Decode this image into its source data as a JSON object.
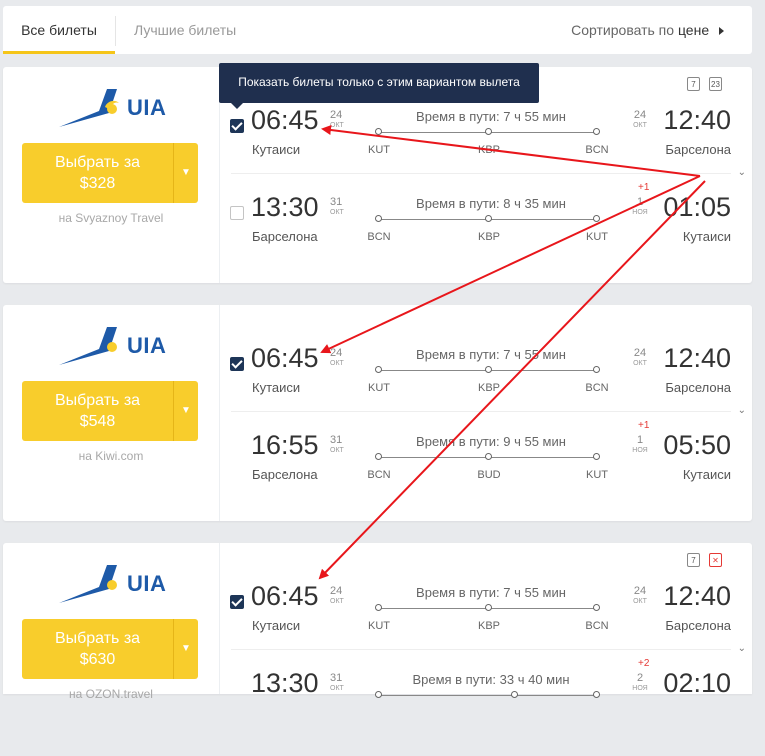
{
  "tabs": {
    "all": "Все билеты",
    "best": "Лучшие билеты"
  },
  "sort": {
    "prefix": "Сортировать по",
    "field": "цене"
  },
  "tooltip": "Показать билеты только с этим вариантом вылета",
  "colors": {
    "accent": "#f8cd2c",
    "checkbox": "#1d3557",
    "arrow": "#e8161b",
    "tooltip_bg": "#1f2f4e"
  },
  "cards": [
    {
      "airline": "UIA",
      "buy_label": "Выбрать за",
      "price": "$328",
      "agency": "на Svyaznoy Travel",
      "baggage": [
        "7",
        "23"
      ],
      "outbound": {
        "dep_time": "06:45",
        "dep_day": "24",
        "dep_mon": "ОКТ",
        "dep_city": "Кутаиси",
        "duration": "Время в пути: 7 ч 55 мин",
        "codes": [
          "KUT",
          "KBP",
          "BCN"
        ],
        "arr_time": "12:40",
        "arr_day": "24",
        "arr_mon": "ОКТ",
        "arr_city": "Барселона",
        "plus": ""
      },
      "inbound": {
        "dep_time": "13:30",
        "dep_day": "31",
        "dep_mon": "ОКТ",
        "dep_city": "Барселона",
        "duration": "Время в пути: 8 ч 35 мин",
        "codes": [
          "BCN",
          "KBP",
          "KUT"
        ],
        "arr_time": "01:05",
        "arr_day": "1",
        "arr_mon": "НОЯ",
        "arr_city": "Кутаиси",
        "plus": "+1"
      }
    },
    {
      "airline": "UIA",
      "buy_label": "Выбрать за",
      "price": "$548",
      "agency": "на Kiwi.com",
      "outbound": {
        "dep_time": "06:45",
        "dep_day": "24",
        "dep_mon": "ОКТ",
        "dep_city": "Кутаиси",
        "duration": "Время в пути: 7 ч 55 мин",
        "codes": [
          "KUT",
          "KBP",
          "BCN"
        ],
        "arr_time": "12:40",
        "arr_day": "24",
        "arr_mon": "ОКТ",
        "arr_city": "Барселона",
        "plus": ""
      },
      "inbound": {
        "dep_time": "16:55",
        "dep_day": "31",
        "dep_mon": "ОКТ",
        "dep_city": "Барселона",
        "duration": "Время в пути: 9 ч 55 мин",
        "codes": [
          "BCN",
          "BUD",
          "KUT"
        ],
        "arr_time": "05:50",
        "arr_day": "1",
        "arr_mon": "НОЯ",
        "arr_city": "Кутаиси",
        "plus": "+1"
      }
    },
    {
      "airline": "UIA",
      "buy_label": "Выбрать за",
      "price": "$630",
      "agency": "на OZON.travel",
      "baggage": [
        "7",
        "✕"
      ],
      "outbound": {
        "dep_time": "06:45",
        "dep_day": "24",
        "dep_mon": "ОКТ",
        "dep_city": "Кутаиси",
        "duration": "Время в пути: 7 ч 55 мин",
        "codes": [
          "KUT",
          "KBP",
          "BCN"
        ],
        "arr_time": "12:40",
        "arr_day": "24",
        "arr_mon": "ОКТ",
        "arr_city": "Барселона",
        "plus": ""
      },
      "inbound": {
        "dep_time": "13:30",
        "dep_day": "31",
        "dep_mon": "ОКТ",
        "dep_city": "",
        "duration": "Время в пути: 33 ч 40 мин",
        "codes": [
          "",
          "",
          ""
        ],
        "arr_time": "02:10",
        "arr_day": "2",
        "arr_mon": "НОЯ",
        "arr_city": "",
        "plus": "+2"
      }
    }
  ]
}
